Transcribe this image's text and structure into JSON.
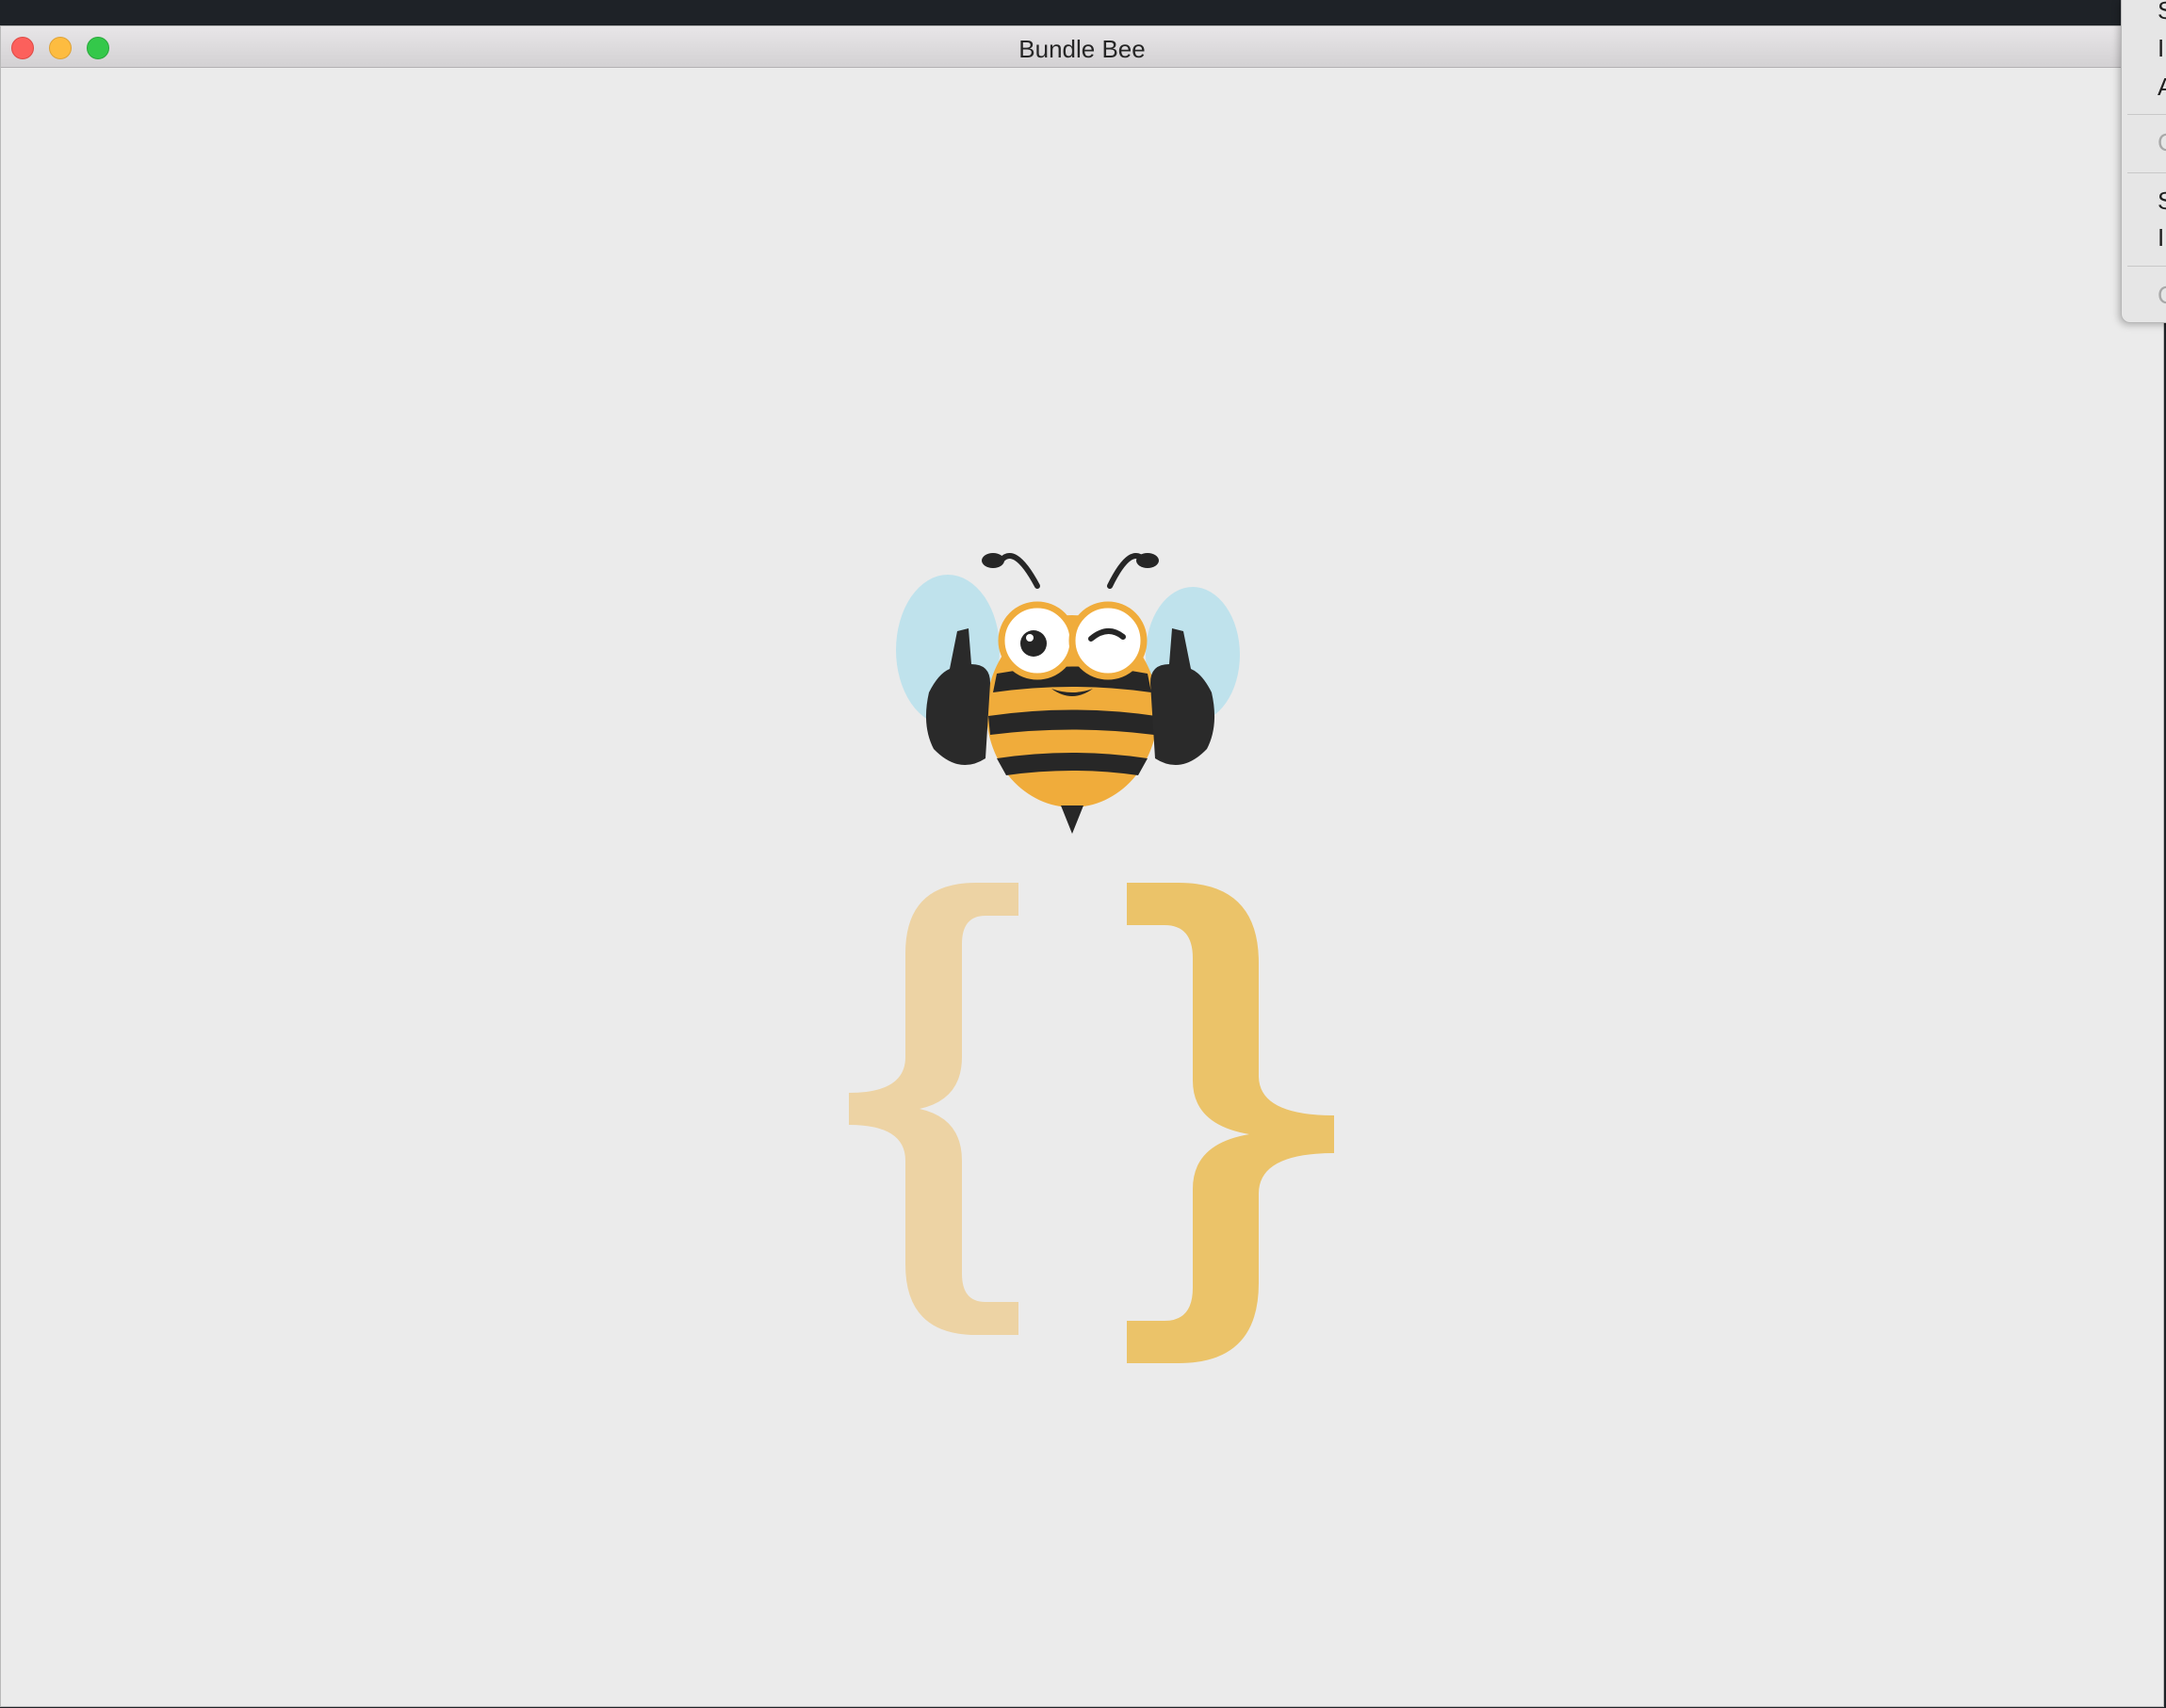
{
  "window": {
    "title": "Bundle Bee"
  },
  "menu": {
    "items": [
      {
        "label": "S",
        "enabled": true
      },
      {
        "label": "I",
        "enabled": true
      },
      {
        "label": "A",
        "enabled": true
      },
      {
        "label": "C",
        "enabled": false
      },
      {
        "label": "S",
        "enabled": true
      },
      {
        "label": "I",
        "enabled": true
      },
      {
        "label": "C",
        "enabled": false
      }
    ]
  },
  "logo": {
    "mascot": "bee-mascot-thumbs-up",
    "symbol": "curly-braces",
    "colors": {
      "left_brace": "#edd3a4",
      "right_brace": "#ebc369",
      "bee_body": "#f0ac3b",
      "bee_stripes": "#272727",
      "bee_wings": "#bfe2ec"
    }
  },
  "colors": {
    "background": "#ebebeb",
    "desktop": "#1e2227"
  }
}
